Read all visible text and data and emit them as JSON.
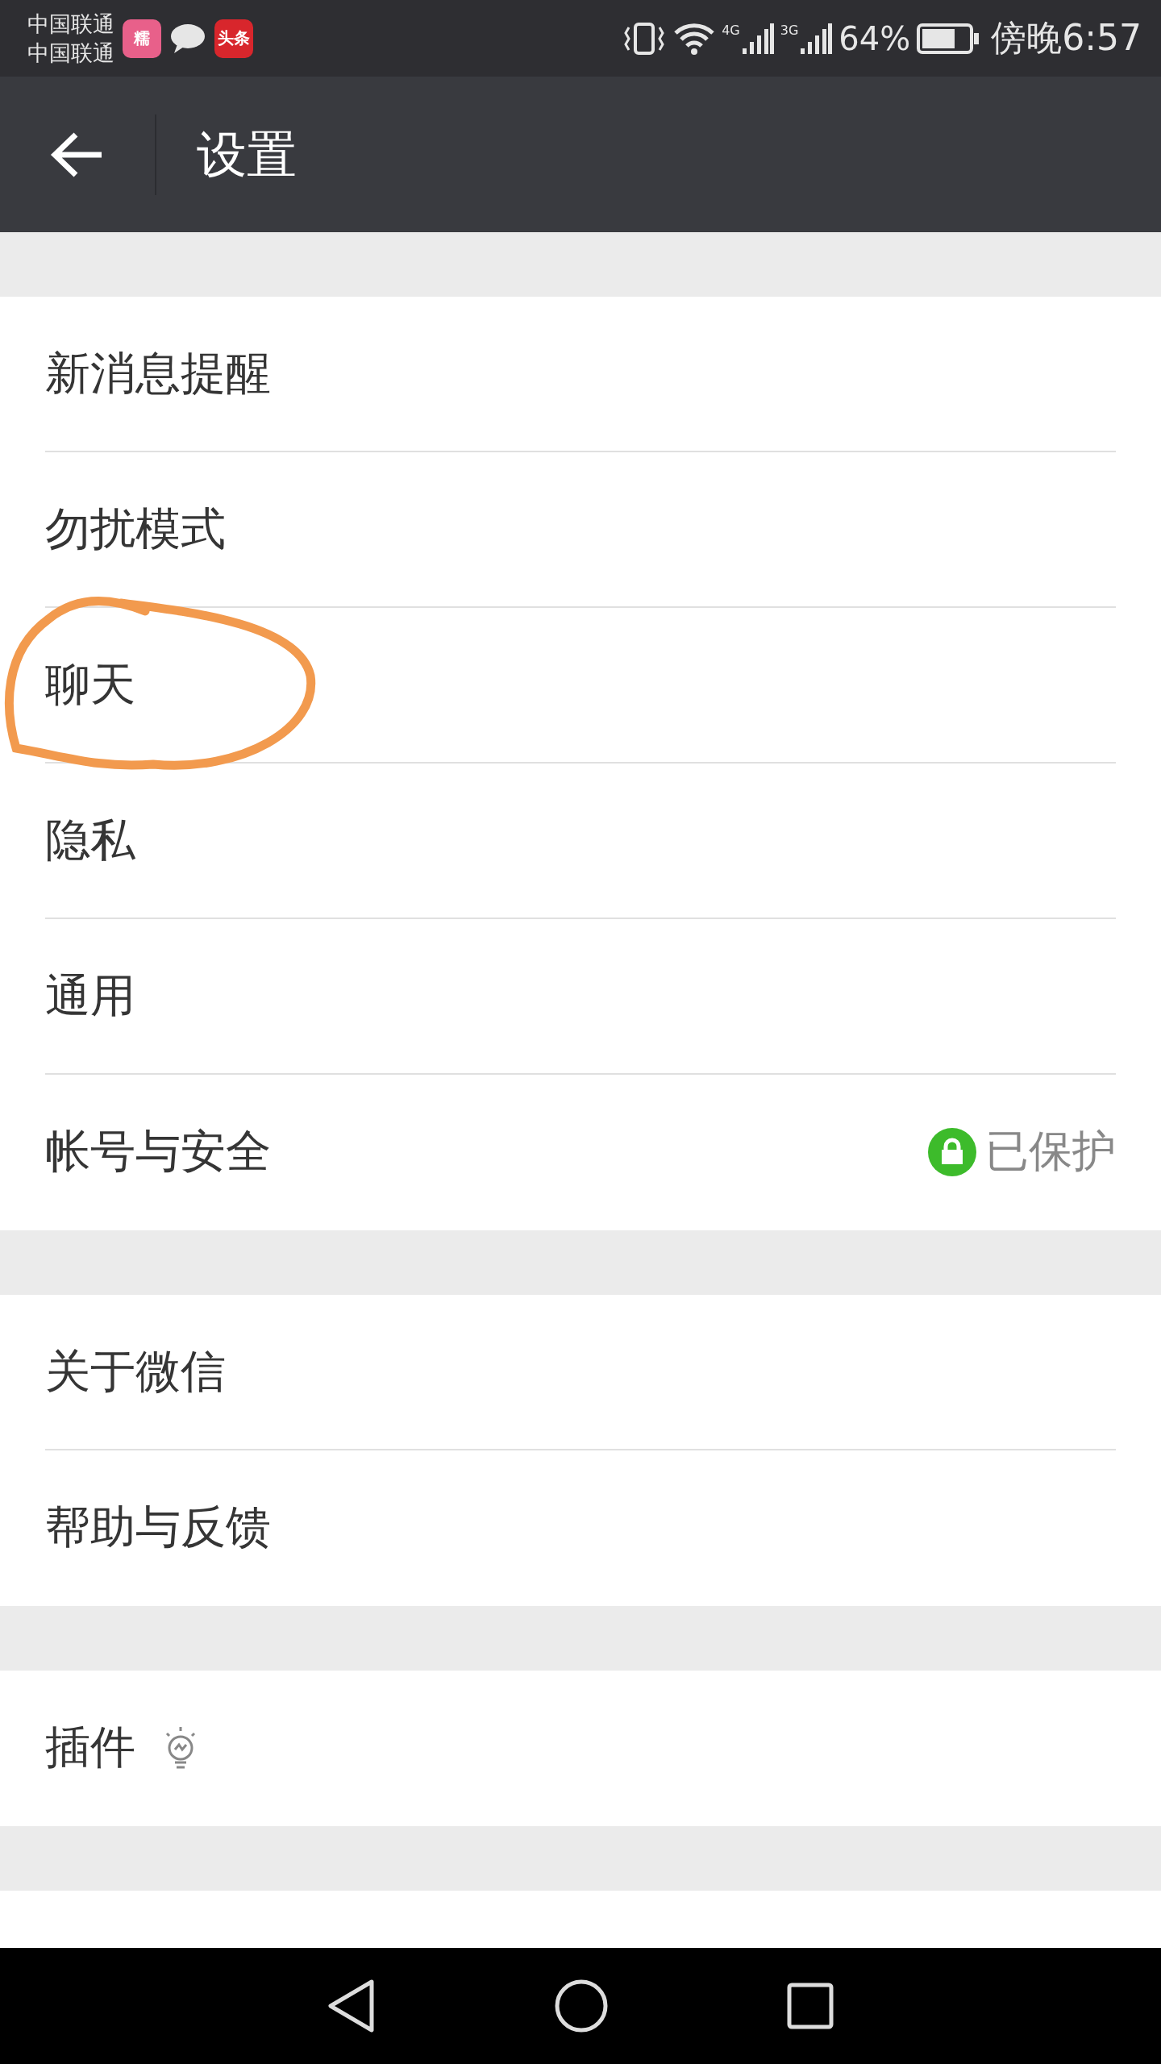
{
  "status_bar": {
    "carriers": [
      "中国联通",
      "中国联通"
    ],
    "notification_icons": [
      {
        "kind": "app",
        "label": "糯",
        "color": "#e8608a"
      },
      {
        "kind": "chat"
      },
      {
        "kind": "app",
        "label": "头条",
        "color": "#d8262c"
      }
    ],
    "networks": [
      {
        "label": "4G"
      },
      {
        "label": "3G"
      }
    ],
    "battery": "64%",
    "time": "傍晚6:57"
  },
  "header": {
    "title": "设置"
  },
  "groups": [
    {
      "items": [
        {
          "label": "新消息提醒",
          "kind": "plain",
          "circled": false
        },
        {
          "label": "勿扰模式",
          "kind": "plain",
          "circled": false
        },
        {
          "label": "聊天",
          "kind": "plain",
          "circled": true
        },
        {
          "label": "隐私",
          "kind": "plain",
          "circled": false
        },
        {
          "label": "通用",
          "kind": "plain",
          "circled": false
        },
        {
          "label": "帐号与安全",
          "kind": "status",
          "status": "已保护",
          "circled": false
        }
      ]
    },
    {
      "items": [
        {
          "label": "关于微信",
          "kind": "plain",
          "circled": false
        },
        {
          "label": "帮助与反馈",
          "kind": "plain",
          "circled": false
        }
      ]
    },
    {
      "items": [
        {
          "label": "插件",
          "kind": "plugin",
          "circled": false
        }
      ]
    }
  ]
}
